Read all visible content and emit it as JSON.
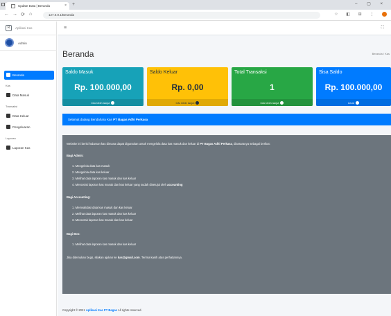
{
  "browser": {
    "tab_title": "Update Data | Beranda",
    "address": "127.0.0.1/Beranda"
  },
  "sidebar": {
    "brand": "Aplikasi Kas",
    "user": "Admin",
    "items": [
      {
        "label": "Beranda",
        "active": true
      },
      {
        "label": "Data Masuk",
        "active": false
      },
      {
        "label": "Data Keluar",
        "active": false
      },
      {
        "label": "Pengeluaran",
        "active": false
      },
      {
        "label": "Laporan Kas",
        "active": false
      }
    ],
    "headers": [
      "Kas",
      "Transaksi",
      "Laporan"
    ]
  },
  "main": {
    "title": "Beranda",
    "breadcrumb": "Beranda / Kas",
    "boxes": [
      {
        "label": "Saldo Masuk",
        "value": "Rp. 100.000,00",
        "footer": "Info lebih lanjut"
      },
      {
        "label": "Saldo Keluar",
        "value": "Rp. 0,00",
        "footer": "Info lebih lanjut"
      },
      {
        "label": "Total Transaksi",
        "value": "1",
        "footer": "Info lebih lanjut"
      },
      {
        "label": "Sisa Saldo",
        "value": "Rp. 100.000,00",
        "footer": "Lihat"
      }
    ],
    "alert": {
      "text": "Selamat datang Bendahara Kas",
      "org": "PT Bagas Adhi Perkasa"
    },
    "card": {
      "intro": "Website ini berisi halaman kas dimana dapat digunakan untuk mengelola data kas masuk dan keluar di",
      "intro_org": "PT Bagas Adhi Perkasa",
      "intro_end": ", diantaranya sebagai berikut:",
      "role1_title": "Bagi Admin:",
      "role1_items": [
        "1. Mengelola data kas masuk",
        "2. Mengelola data kas keluar",
        "3. Melihat data laporan kas masuk dan kas keluar",
        "4. Mencetak laporan kas masuk dan kas keluar yang sudah disetujui oleh"
      ],
      "role1_items_bold": "accounting",
      "role2_title": "Bagi Accounting:",
      "role2_items": [
        "1. Memvalidasi data kas masuk dan kas keluar",
        "2. Melihat data laporan kas masuk dan kas keluar",
        "3. Mencetak laporan kas masuk dan kas keluar"
      ],
      "role3_title": "Bagi Bos:",
      "role3_items": [
        "1. Melihat data laporan kas masuk dan kas keluar"
      ],
      "contact": "Jika ditemukan bugs, silakan ajukan ke",
      "contact_email": "kas@gmail.com",
      "contact_end": ". Terima kasih atas perhatiannya."
    },
    "footer": {
      "text": "Copyright © 2021",
      "brand": "Aplikasi Kas PT Bagas",
      "rights": "All rights reserved."
    }
  },
  "colors": {
    "info": "#17a2b8",
    "warning": "#ffc107",
    "success": "#28a745",
    "primary": "#007bff",
    "secondary": "#6c757d"
  }
}
